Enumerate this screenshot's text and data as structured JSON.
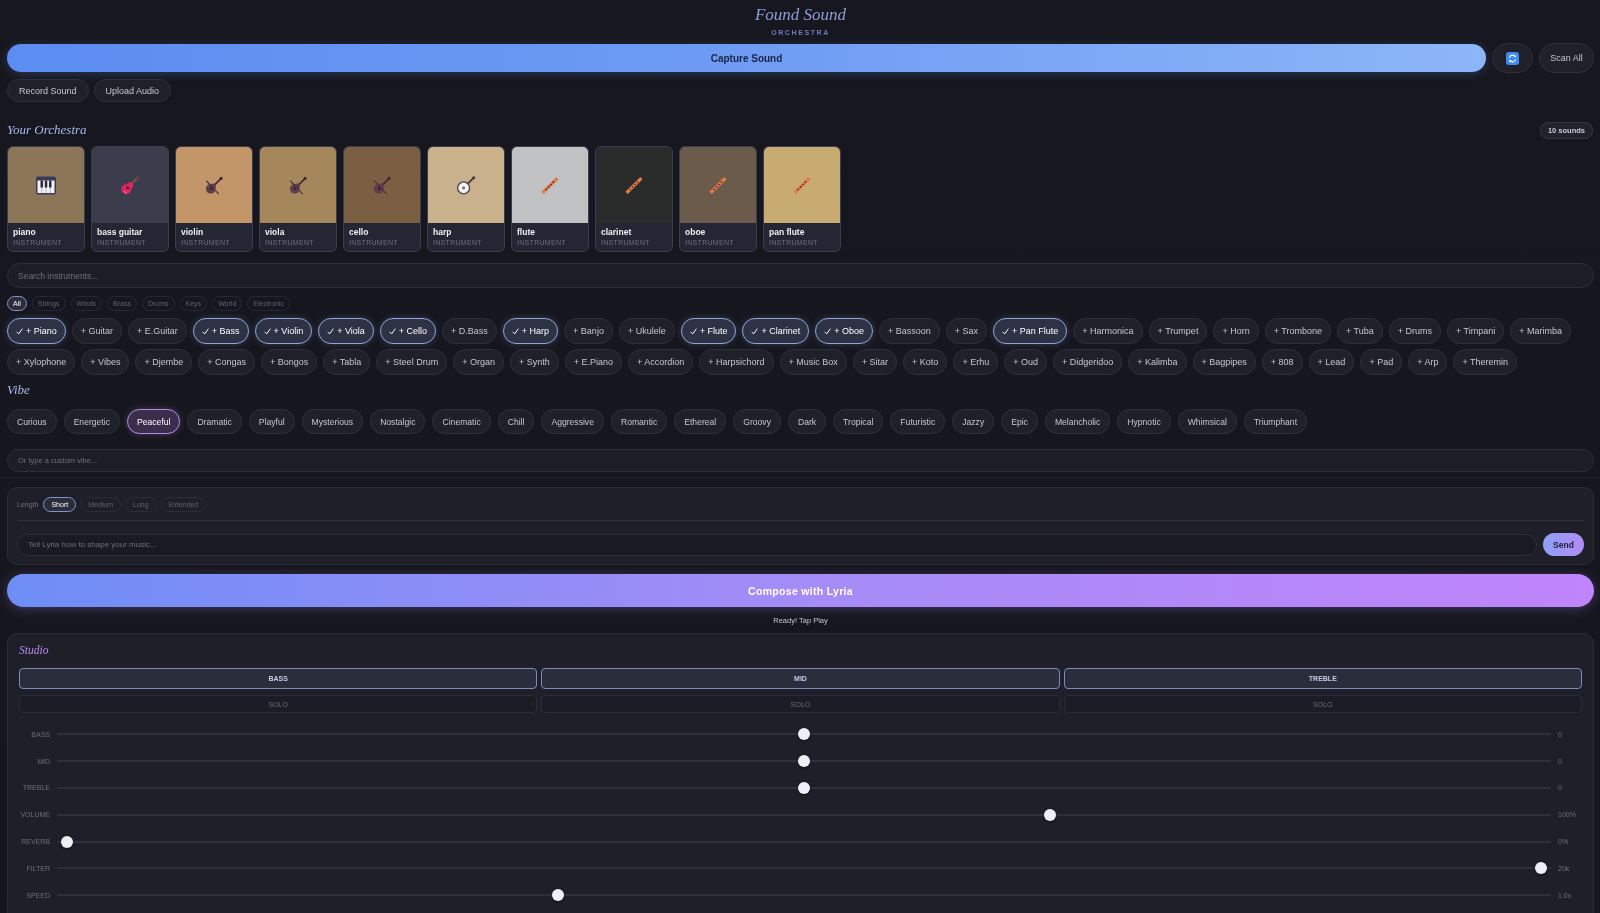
{
  "header": {
    "title": "Found Sound",
    "subtitle": "ORCHESTRA"
  },
  "capture": {
    "label": "Capture Sound",
    "scan_all": "Scan All"
  },
  "source_buttons": [
    "Record Sound",
    "Upload Audio"
  ],
  "orchestra": {
    "title": "Your Orchestra",
    "count": "10 sounds",
    "cards": [
      {
        "name": "piano",
        "type": "INSTRUMENT",
        "kind": "keyboard",
        "color": "#8b7657"
      },
      {
        "name": "bass guitar",
        "type": "INSTRUMENT",
        "kind": "guitar",
        "color": "#3b3c4c"
      },
      {
        "name": "violin",
        "type": "INSTRUMENT",
        "kind": "violin",
        "color": "#c29669"
      },
      {
        "name": "viola",
        "type": "INSTRUMENT",
        "kind": "violin",
        "color": "#a6875c"
      },
      {
        "name": "cello",
        "type": "INSTRUMENT",
        "kind": "violin",
        "color": "#7b5f42"
      },
      {
        "name": "harp",
        "type": "INSTRUMENT",
        "kind": "banjo",
        "color": "#c9b18c"
      },
      {
        "name": "flute",
        "type": "INSTRUMENT",
        "kind": "flute",
        "color": "#c1c2c4"
      },
      {
        "name": "clarinet",
        "type": "INSTRUMENT",
        "kind": "flute",
        "color": "#2a2c2c"
      },
      {
        "name": "oboe",
        "type": "INSTRUMENT",
        "kind": "flute",
        "color": "#6b5b4a"
      },
      {
        "name": "pan flute",
        "type": "INSTRUMENT",
        "kind": "flute",
        "color": "#c7ab70"
      }
    ]
  },
  "instrument_search": {
    "placeholder": "Search instruments..."
  },
  "filters": [
    {
      "label": "All",
      "selected": true
    },
    {
      "label": "Strings",
      "selected": false
    },
    {
      "label": "Winds",
      "selected": false
    },
    {
      "label": "Brass",
      "selected": false
    },
    {
      "label": "Drums",
      "selected": false
    },
    {
      "label": "Keys",
      "selected": false
    },
    {
      "label": "World",
      "selected": false
    },
    {
      "label": "Electronic",
      "selected": false
    }
  ],
  "instruments": [
    {
      "label": "+ Piano",
      "selected": true
    },
    {
      "label": "+ Guitar",
      "selected": false
    },
    {
      "label": "+ E.Guitar",
      "selected": false
    },
    {
      "label": "+ Bass",
      "selected": true
    },
    {
      "label": "+ Violin",
      "selected": true
    },
    {
      "label": "+ Viola",
      "selected": true
    },
    {
      "label": "+ Cello",
      "selected": true
    },
    {
      "label": "+ D.Bass",
      "selected": false
    },
    {
      "label": "+ Harp",
      "selected": true
    },
    {
      "label": "+ Banjo",
      "selected": false
    },
    {
      "label": "+ Ukulele",
      "selected": false
    },
    {
      "label": "+ Flute",
      "selected": true
    },
    {
      "label": "+ Clarinet",
      "selected": true
    },
    {
      "label": "+ Oboe",
      "selected": true
    },
    {
      "label": "+ Bassoon",
      "selected": false
    },
    {
      "label": "+ Sax",
      "selected": false
    },
    {
      "label": "+ Pan Flute",
      "selected": true
    },
    {
      "label": "+ Harmonica",
      "selected": false
    },
    {
      "label": "+ Trumpet",
      "selected": false
    },
    {
      "label": "+ Horn",
      "selected": false
    },
    {
      "label": "+ Trombone",
      "selected": false
    },
    {
      "label": "+ Tuba",
      "selected": false
    },
    {
      "label": "+ Drums",
      "selected": false
    },
    {
      "label": "+ Timpani",
      "selected": false
    },
    {
      "label": "+ Marimba",
      "selected": false
    },
    {
      "label": "+ Xylophone",
      "selected": false
    },
    {
      "label": "+ Vibes",
      "selected": false
    },
    {
      "label": "+ Djembe",
      "selected": false
    },
    {
      "label": "+ Congas",
      "selected": false
    },
    {
      "label": "+ Bongos",
      "selected": false
    },
    {
      "label": "+ Tabla",
      "selected": false
    },
    {
      "label": "+ Steel Drum",
      "selected": false
    },
    {
      "label": "+ Organ",
      "selected": false
    },
    {
      "label": "+ Synth",
      "selected": false
    },
    {
      "label": "+ E.Piano",
      "selected": false
    },
    {
      "label": "+ Accordion",
      "selected": false
    },
    {
      "label": "+ Harpsichord",
      "selected": false
    },
    {
      "label": "+ Music Box",
      "selected": false
    },
    {
      "label": "+ Sitar",
      "selected": false
    },
    {
      "label": "+ Koto",
      "selected": false
    },
    {
      "label": "+ Erhu",
      "selected": false
    },
    {
      "label": "+ Oud",
      "selected": false
    },
    {
      "label": "+ Didgeridoo",
      "selected": false
    },
    {
      "label": "+ Kalimba",
      "selected": false
    },
    {
      "label": "+ Bagpipes",
      "selected": false
    },
    {
      "label": "+ 808",
      "selected": false
    },
    {
      "label": "+ Lead",
      "selected": false
    },
    {
      "label": "+ Pad",
      "selected": false
    },
    {
      "label": "+ Arp",
      "selected": false
    },
    {
      "label": "+ Theremin",
      "selected": false
    }
  ],
  "vibe": {
    "title": "Vibe",
    "options": [
      {
        "label": "Curious",
        "selected": false
      },
      {
        "label": "Energetic",
        "selected": false
      },
      {
        "label": "Peaceful",
        "selected": true
      },
      {
        "label": "Dramatic",
        "selected": false
      },
      {
        "label": "Playful",
        "selected": false
      },
      {
        "label": "Mysterious",
        "selected": false
      },
      {
        "label": "Nostalgic",
        "selected": false
      },
      {
        "label": "Cinematic",
        "selected": false
      },
      {
        "label": "Chill",
        "selected": false
      },
      {
        "label": "Aggressive",
        "selected": false
      },
      {
        "label": "Romantic",
        "selected": false
      },
      {
        "label": "Ethereal",
        "selected": false
      },
      {
        "label": "Groovy",
        "selected": false
      },
      {
        "label": "Dark",
        "selected": false
      },
      {
        "label": "Tropical",
        "selected": false
      },
      {
        "label": "Futuristic",
        "selected": false
      },
      {
        "label": "Jazzy",
        "selected": false
      },
      {
        "label": "Epic",
        "selected": false
      },
      {
        "label": "Melancholic",
        "selected": false
      },
      {
        "label": "Hypnotic",
        "selected": false
      },
      {
        "label": "Whimsical",
        "selected": false
      },
      {
        "label": "Triumphant",
        "selected": false
      }
    ],
    "custom": {
      "placeholder": "Or type a custom vibe..."
    }
  },
  "prompt_panel": {
    "length_label": "Length",
    "lengths": [
      {
        "label": "Short",
        "selected": true
      },
      {
        "label": "Medium",
        "selected": false
      },
      {
        "label": "Long",
        "selected": false
      },
      {
        "label": "Extended",
        "selected": false
      }
    ],
    "prompt": {
      "placeholder": "Tell Lyria how to shape your music..."
    },
    "send": "Send"
  },
  "compose": {
    "label": "Compose with Lyria",
    "status": "Ready! Tap Play"
  },
  "studio": {
    "title": "Studio",
    "bands": [
      {
        "label": "BASS",
        "solo": "SOLO"
      },
      {
        "label": "MID",
        "solo": "SOLO"
      },
      {
        "label": "TREBLE",
        "solo": "SOLO"
      }
    ],
    "sliders": [
      {
        "label": "BASS",
        "level": 0.5,
        "reading": "0"
      },
      {
        "label": "MID",
        "level": 0.5,
        "reading": "0"
      },
      {
        "label": "TREBLE",
        "level": 0.5,
        "reading": "0"
      },
      {
        "label": "VOLUME",
        "level": 0.667,
        "reading": "100%"
      },
      {
        "label": "REVERB",
        "level": 0,
        "reading": "0%"
      },
      {
        "label": "FILTER",
        "level": 1,
        "reading": "20k"
      },
      {
        "label": "SPEED",
        "level": 0.333,
        "reading": "1.0x"
      }
    ]
  }
}
